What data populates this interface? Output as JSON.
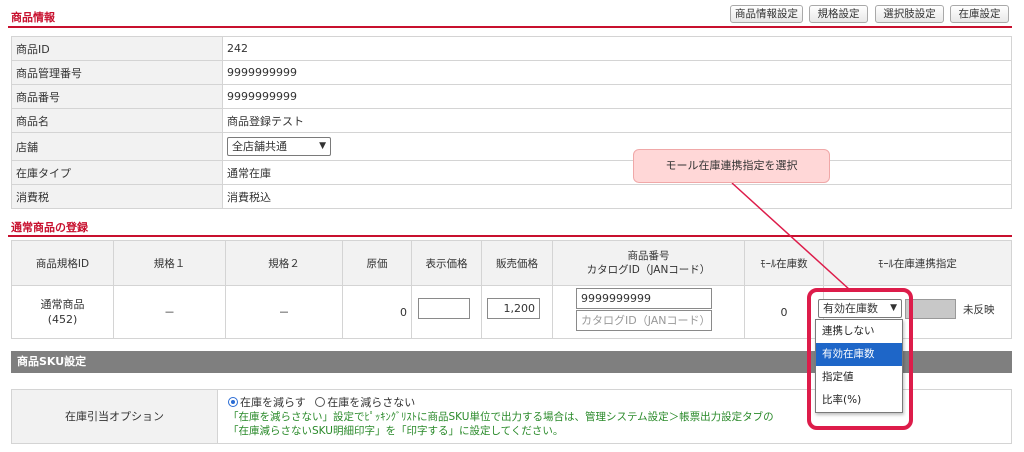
{
  "header": {
    "section_title": "商品情報",
    "buttons": [
      "商品情報設定",
      "規格設定",
      "選択肢設定",
      "在庫設定"
    ]
  },
  "info_rows": [
    {
      "label": "商品ID",
      "value": "242"
    },
    {
      "label": "商品管理番号",
      "value": "9999999999"
    },
    {
      "label": "商品番号",
      "value": "9999999999"
    },
    {
      "label": "商品名",
      "value": "商品登録テスト"
    },
    {
      "label": "店舗",
      "value": "全店舗共通",
      "type": "select"
    },
    {
      "label": "在庫タイプ",
      "value": "通常在庫"
    },
    {
      "label": "消費税",
      "value": "消費税込"
    }
  ],
  "callout": {
    "text": "モール在庫連携指定を選択"
  },
  "registration": {
    "section_title": "通常商品の登録",
    "columns": [
      "商品規格ID",
      "規格１",
      "規格２",
      "原価",
      "表示価格",
      "販売価格",
      "商品番号",
      "カタログID（JANコード）",
      "ﾓｰﾙ在庫数",
      "ﾓｰﾙ在庫連携指定"
    ],
    "row": {
      "id_name": "通常商品",
      "id_num": "(452)",
      "spec1": "－",
      "spec2": "－",
      "cost": "0",
      "display_price": "",
      "sale_price": "1,200",
      "product_number": "9999999999",
      "catalog_placeholder": "カタログID（JANコード）",
      "mall_stock": "0",
      "link_select": "有効在庫数",
      "not_reflected": "未反映"
    }
  },
  "dropdown": {
    "options": [
      "連携しない",
      "有効在庫数",
      "指定値",
      "比率(%)"
    ],
    "selected_index": 1
  },
  "sku": {
    "section_title": "商品SKU設定",
    "option_label": "在庫引当オプション",
    "radio_on": "在庫を減らす",
    "radio_off": "在庫を減らさない",
    "note_line1": "「在庫を減らさない」設定でﾋﾟｯｷﾝｸﾞﾘｽﾄに商品SKU単位で出力する場合は、管理システム設定＞帳票出力設定タブの",
    "note_line2": "「在庫減らさないSKU明細印字」を「印字する」に設定してください。"
  },
  "colors": {
    "accent_red": "#c8102e",
    "highlight": "#dd1c4a",
    "callout_bg": "#ffd7d7",
    "selected_blue": "#1e66c8",
    "note_green": "#2a8a2a"
  }
}
